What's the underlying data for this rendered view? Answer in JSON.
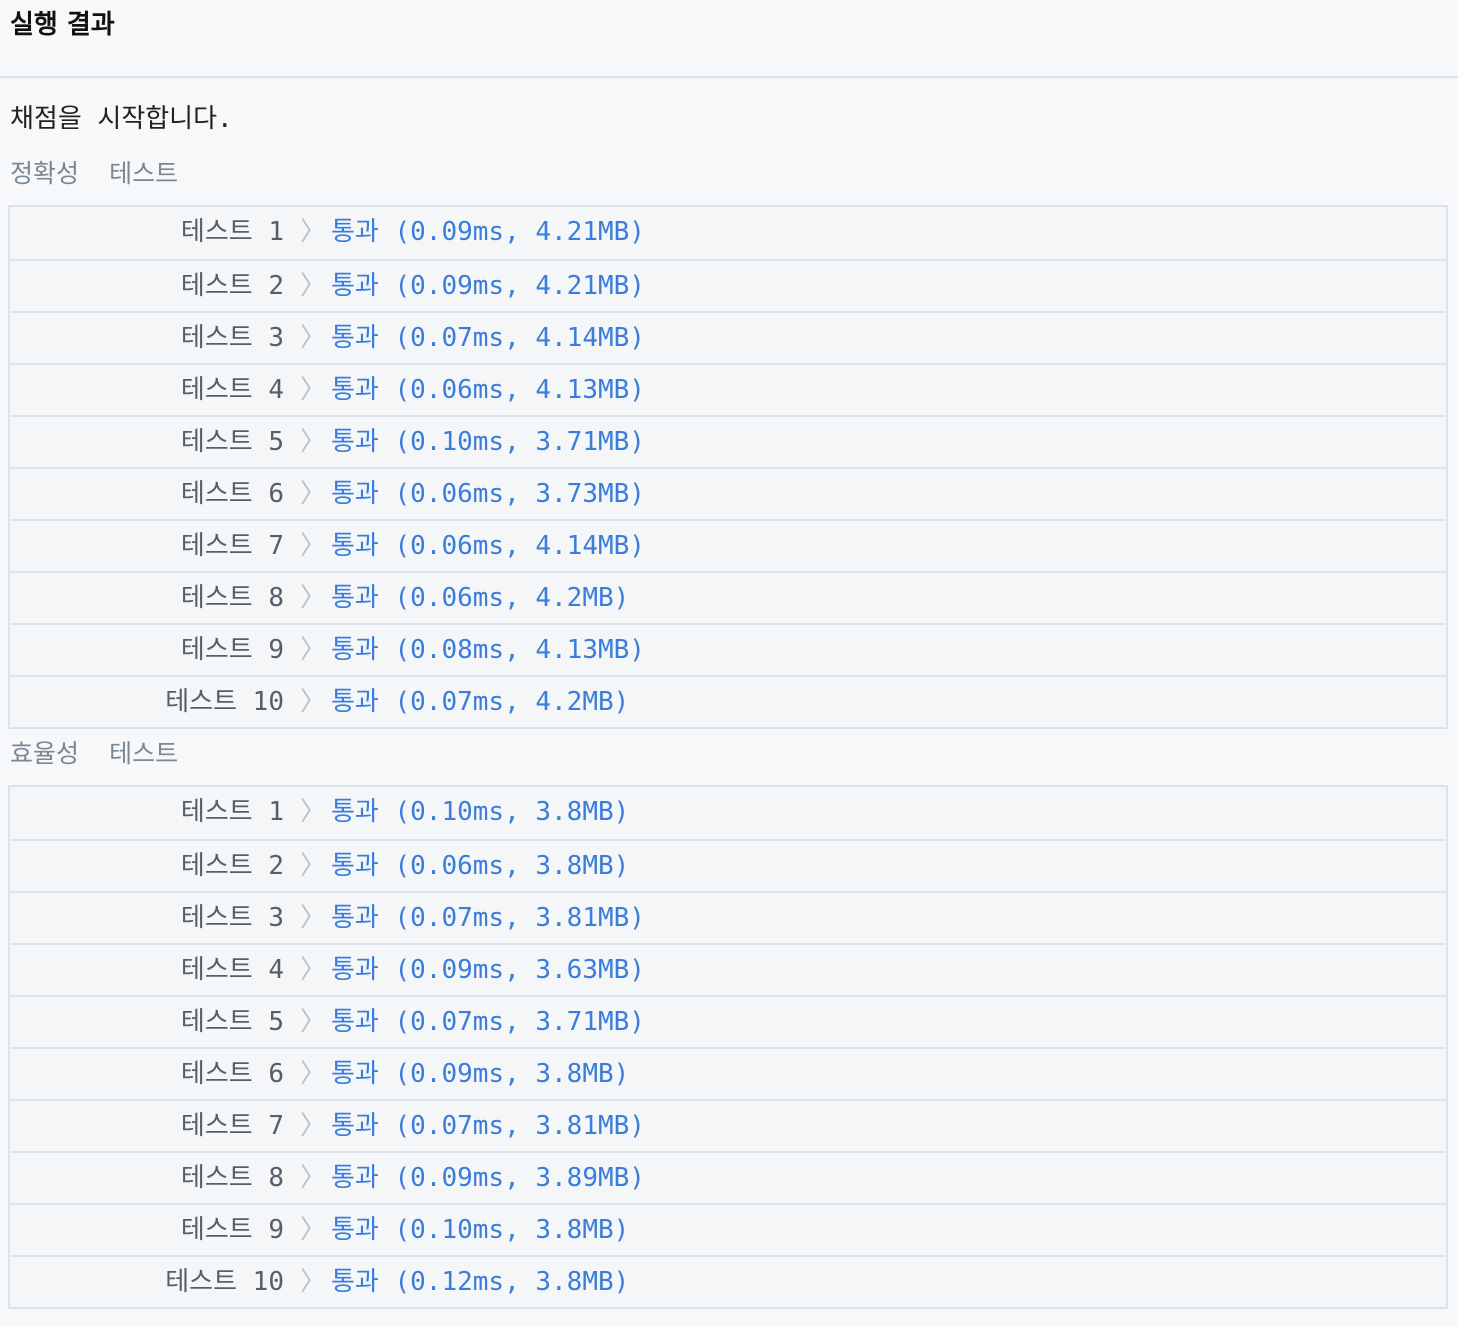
{
  "header": {
    "title": "실행 결과"
  },
  "console": {
    "start_message": "채점을 시작합니다.",
    "sections": [
      {
        "title": "정확성  테스트",
        "rows": [
          {
            "label": "테스트 1",
            "result": "통과 (0.09ms, 4.21MB)"
          },
          {
            "label": "테스트 2",
            "result": "통과 (0.09ms, 4.21MB)"
          },
          {
            "label": "테스트 3",
            "result": "통과 (0.07ms, 4.14MB)"
          },
          {
            "label": "테스트 4",
            "result": "통과 (0.06ms, 4.13MB)"
          },
          {
            "label": "테스트 5",
            "result": "통과 (0.10ms, 3.71MB)"
          },
          {
            "label": "테스트 6",
            "result": "통과 (0.06ms, 3.73MB)"
          },
          {
            "label": "테스트 7",
            "result": "통과 (0.06ms, 4.14MB)"
          },
          {
            "label": "테스트 8",
            "result": "통과 (0.06ms, 4.2MB)"
          },
          {
            "label": "테스트 9",
            "result": "통과 (0.08ms, 4.13MB)"
          },
          {
            "label": "테스트 10",
            "result": "통과 (0.07ms, 4.2MB)"
          }
        ]
      },
      {
        "title": "효율성  테스트",
        "rows": [
          {
            "label": "테스트 1",
            "result": "통과 (0.10ms, 3.8MB)"
          },
          {
            "label": "테스트 2",
            "result": "통과 (0.06ms, 3.8MB)"
          },
          {
            "label": "테스트 3",
            "result": "통과 (0.07ms, 3.81MB)"
          },
          {
            "label": "테스트 4",
            "result": "통과 (0.09ms, 3.63MB)"
          },
          {
            "label": "테스트 5",
            "result": "통과 (0.07ms, 3.71MB)"
          },
          {
            "label": "테스트 6",
            "result": "통과 (0.09ms, 3.8MB)"
          },
          {
            "label": "테스트 7",
            "result": "통과 (0.07ms, 3.81MB)"
          },
          {
            "label": "테스트 8",
            "result": "통과 (0.09ms, 3.89MB)"
          },
          {
            "label": "테스트 9",
            "result": "통과 (0.10ms, 3.8MB)"
          },
          {
            "label": "테스트 10",
            "result": "통과 (0.12ms, 3.8MB)"
          }
        ]
      }
    ]
  },
  "colors": {
    "pass": "#3b7ddd",
    "label": "#555f6b",
    "section_title": "#7a8794",
    "border": "#dde3ea"
  },
  "icons": {
    "row_separator": "chevron-right-icon"
  }
}
